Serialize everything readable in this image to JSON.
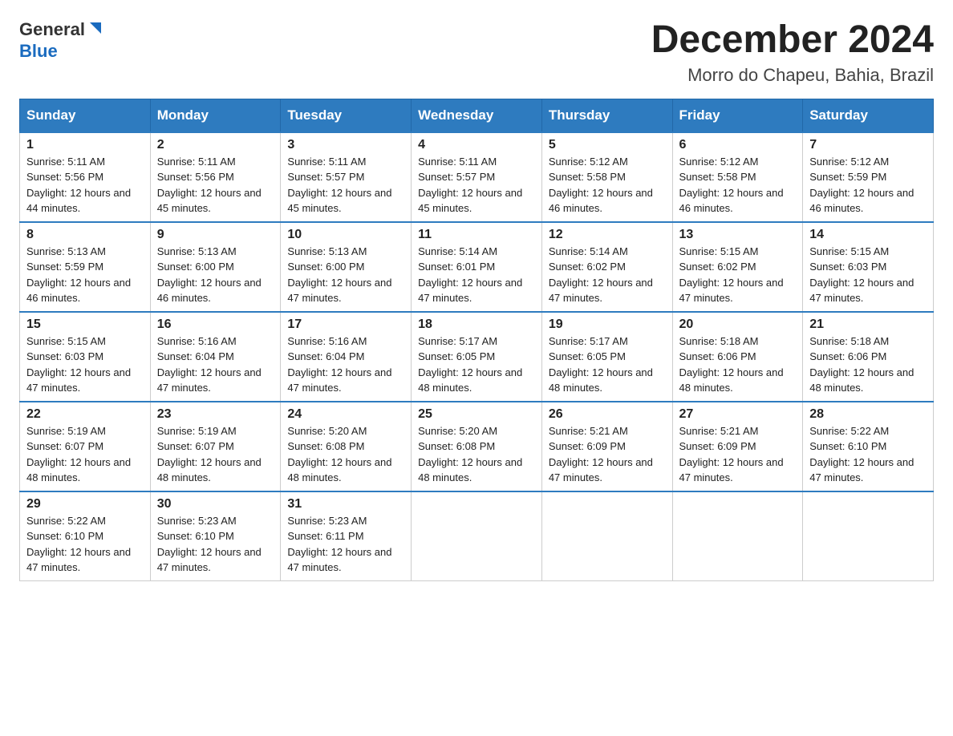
{
  "header": {
    "logo_general": "General",
    "logo_blue": "Blue",
    "title": "December 2024",
    "location": "Morro do Chapeu, Bahia, Brazil"
  },
  "days_of_week": [
    "Sunday",
    "Monday",
    "Tuesday",
    "Wednesday",
    "Thursday",
    "Friday",
    "Saturday"
  ],
  "weeks": [
    [
      {
        "day": "1",
        "sunrise": "5:11 AM",
        "sunset": "5:56 PM",
        "daylight": "12 hours and 44 minutes."
      },
      {
        "day": "2",
        "sunrise": "5:11 AM",
        "sunset": "5:56 PM",
        "daylight": "12 hours and 45 minutes."
      },
      {
        "day": "3",
        "sunrise": "5:11 AM",
        "sunset": "5:57 PM",
        "daylight": "12 hours and 45 minutes."
      },
      {
        "day": "4",
        "sunrise": "5:11 AM",
        "sunset": "5:57 PM",
        "daylight": "12 hours and 45 minutes."
      },
      {
        "day": "5",
        "sunrise": "5:12 AM",
        "sunset": "5:58 PM",
        "daylight": "12 hours and 46 minutes."
      },
      {
        "day": "6",
        "sunrise": "5:12 AM",
        "sunset": "5:58 PM",
        "daylight": "12 hours and 46 minutes."
      },
      {
        "day": "7",
        "sunrise": "5:12 AM",
        "sunset": "5:59 PM",
        "daylight": "12 hours and 46 minutes."
      }
    ],
    [
      {
        "day": "8",
        "sunrise": "5:13 AM",
        "sunset": "5:59 PM",
        "daylight": "12 hours and 46 minutes."
      },
      {
        "day": "9",
        "sunrise": "5:13 AM",
        "sunset": "6:00 PM",
        "daylight": "12 hours and 46 minutes."
      },
      {
        "day": "10",
        "sunrise": "5:13 AM",
        "sunset": "6:00 PM",
        "daylight": "12 hours and 47 minutes."
      },
      {
        "day": "11",
        "sunrise": "5:14 AM",
        "sunset": "6:01 PM",
        "daylight": "12 hours and 47 minutes."
      },
      {
        "day": "12",
        "sunrise": "5:14 AM",
        "sunset": "6:02 PM",
        "daylight": "12 hours and 47 minutes."
      },
      {
        "day": "13",
        "sunrise": "5:15 AM",
        "sunset": "6:02 PM",
        "daylight": "12 hours and 47 minutes."
      },
      {
        "day": "14",
        "sunrise": "5:15 AM",
        "sunset": "6:03 PM",
        "daylight": "12 hours and 47 minutes."
      }
    ],
    [
      {
        "day": "15",
        "sunrise": "5:15 AM",
        "sunset": "6:03 PM",
        "daylight": "12 hours and 47 minutes."
      },
      {
        "day": "16",
        "sunrise": "5:16 AM",
        "sunset": "6:04 PM",
        "daylight": "12 hours and 47 minutes."
      },
      {
        "day": "17",
        "sunrise": "5:16 AM",
        "sunset": "6:04 PM",
        "daylight": "12 hours and 47 minutes."
      },
      {
        "day": "18",
        "sunrise": "5:17 AM",
        "sunset": "6:05 PM",
        "daylight": "12 hours and 48 minutes."
      },
      {
        "day": "19",
        "sunrise": "5:17 AM",
        "sunset": "6:05 PM",
        "daylight": "12 hours and 48 minutes."
      },
      {
        "day": "20",
        "sunrise": "5:18 AM",
        "sunset": "6:06 PM",
        "daylight": "12 hours and 48 minutes."
      },
      {
        "day": "21",
        "sunrise": "5:18 AM",
        "sunset": "6:06 PM",
        "daylight": "12 hours and 48 minutes."
      }
    ],
    [
      {
        "day": "22",
        "sunrise": "5:19 AM",
        "sunset": "6:07 PM",
        "daylight": "12 hours and 48 minutes."
      },
      {
        "day": "23",
        "sunrise": "5:19 AM",
        "sunset": "6:07 PM",
        "daylight": "12 hours and 48 minutes."
      },
      {
        "day": "24",
        "sunrise": "5:20 AM",
        "sunset": "6:08 PM",
        "daylight": "12 hours and 48 minutes."
      },
      {
        "day": "25",
        "sunrise": "5:20 AM",
        "sunset": "6:08 PM",
        "daylight": "12 hours and 48 minutes."
      },
      {
        "day": "26",
        "sunrise": "5:21 AM",
        "sunset": "6:09 PM",
        "daylight": "12 hours and 47 minutes."
      },
      {
        "day": "27",
        "sunrise": "5:21 AM",
        "sunset": "6:09 PM",
        "daylight": "12 hours and 47 minutes."
      },
      {
        "day": "28",
        "sunrise": "5:22 AM",
        "sunset": "6:10 PM",
        "daylight": "12 hours and 47 minutes."
      }
    ],
    [
      {
        "day": "29",
        "sunrise": "5:22 AM",
        "sunset": "6:10 PM",
        "daylight": "12 hours and 47 minutes."
      },
      {
        "day": "30",
        "sunrise": "5:23 AM",
        "sunset": "6:10 PM",
        "daylight": "12 hours and 47 minutes."
      },
      {
        "day": "31",
        "sunrise": "5:23 AM",
        "sunset": "6:11 PM",
        "daylight": "12 hours and 47 minutes."
      },
      null,
      null,
      null,
      null
    ]
  ],
  "labels": {
    "sunrise": "Sunrise:",
    "sunset": "Sunset:",
    "daylight": "Daylight:"
  }
}
